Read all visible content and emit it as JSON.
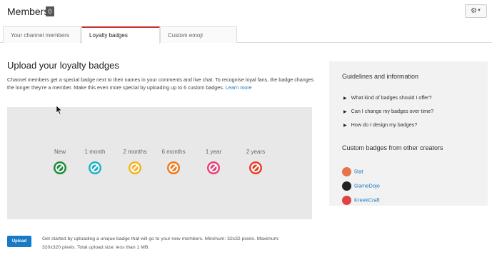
{
  "header": {
    "title": "Members",
    "count": "0",
    "settings_icon": "gear-icon"
  },
  "tabs": [
    {
      "label": "Your channel members",
      "active": false
    },
    {
      "label": "Loyalty badges",
      "active": true
    },
    {
      "label": "Custom emoji",
      "active": false
    }
  ],
  "main": {
    "heading": "Upload your loyalty badges",
    "description": "Channel members get a special badge next to their names in your comments and live chat. To recognise loyal fans, the badge changes the longer they're a member. Make this even more special by uploading up to 6 custom badges.",
    "learn_more": "Learn more"
  },
  "badges": [
    {
      "label": "New",
      "color": "#1e8a3a"
    },
    {
      "label": "1 month",
      "color": "#22b0c3"
    },
    {
      "label": "2 months",
      "color": "#f2b31f"
    },
    {
      "label": "6 months",
      "color": "#ef7a1a"
    },
    {
      "label": "1 year",
      "color": "#e7427a"
    },
    {
      "label": "2 years",
      "color": "#e8402a"
    }
  ],
  "upload": {
    "button_label": "Upload",
    "help_text": "Get started by uploading a unique badge that will go to your new members. Minimum: 32x32 pixels. Maximum: 320x320 pixels. Total upload size: less than 1 MB."
  },
  "sidebar": {
    "guidelines_heading": "Guidelines and information",
    "questions": [
      "What kind of badges should I offer?",
      "Can I change my badges over time?",
      "How do I design my badges?"
    ],
    "creators_heading": "Custom badges from other creators",
    "creators": [
      {
        "name": "5tat",
        "color": "#e8734a"
      },
      {
        "name": "GameDojo",
        "color": "#222222"
      },
      {
        "name": "KreekCraft",
        "color": "#d44"
      }
    ]
  },
  "colors": {
    "accent": "#167ac6",
    "tab_active": "#c9302c"
  }
}
